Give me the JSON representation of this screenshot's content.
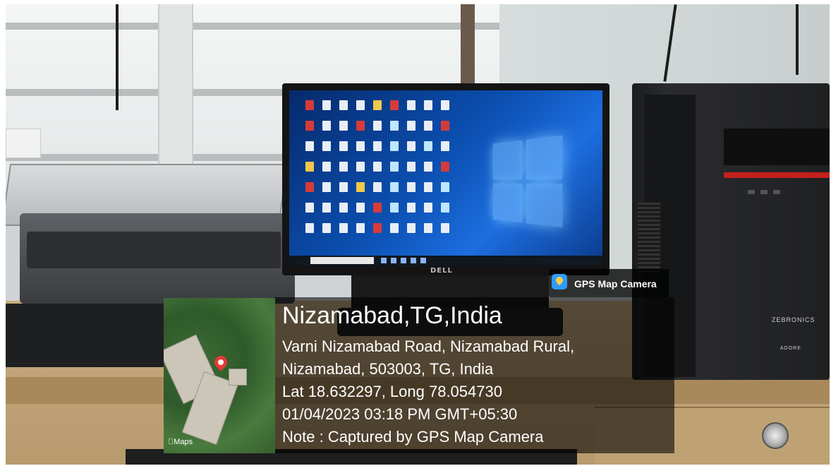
{
  "gps_badge": {
    "label": "GPS Map Camera",
    "icon": "gps-map-camera-icon"
  },
  "location": {
    "title": "Nizamabad,TG,India",
    "address_line1": "Varni Nizamabad Road, Nizamabad Rural,",
    "address_line2": "Nizamabad, 503003, TG, India",
    "coordinates": "Lat 18.632297, Long 78.054730",
    "datetime": "01/04/2023 03:18 PM GMT+05:30",
    "note": "Note : Captured by GPS Map Camera"
  },
  "map": {
    "logo_label": "Maps",
    "pin_icon": "map-pin-icon"
  },
  "equipment": {
    "monitor_brand": "DELL",
    "tower_brand": "ZEBRONICS",
    "tower_model": "ADORE"
  },
  "colors": {
    "overlay": "#000000",
    "badge_icon": "#2f9bff",
    "map_pin": "#e53935",
    "tower_accent": "#c41f1f"
  }
}
